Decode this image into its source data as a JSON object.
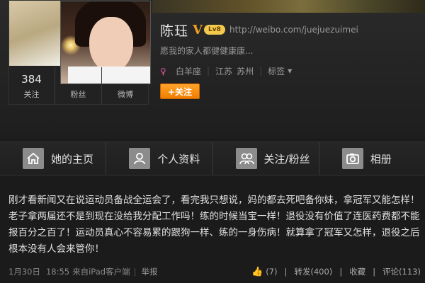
{
  "profile": {
    "name": "陈珏",
    "v_badge": "V",
    "level_badge": "Lv8",
    "url": "http://weibo.com/juejuezuimei",
    "bio": "愿我的家人都健健康康...",
    "gender_glyph": "♀",
    "zodiac": "白羊座",
    "location_province": "江苏",
    "location_city": "苏州",
    "tags_label": "标签",
    "follow_button": "+关注"
  },
  "stats": [
    {
      "value": "384",
      "label": "关注"
    },
    {
      "value": "",
      "label": "粉丝"
    },
    {
      "value": "",
      "label": "微博"
    }
  ],
  "nav": [
    {
      "label": "她的主页",
      "icon": "home-icon"
    },
    {
      "label": "个人资料",
      "icon": "person-icon"
    },
    {
      "label": "关注/粉丝",
      "icon": "people-icon"
    },
    {
      "label": "相册",
      "icon": "camera-icon"
    }
  ],
  "post": {
    "text": "刚才看新闻又在说运动员备战全运会了，看完我只想说，妈的都去死吧备你妹，拿冠军又能怎样！老子拿两届还不是到现在没给我分配工作吗！练的时候当宝一样！退役没有价值了连医药费都不能报百分之百了！运动员真心不容易累的跟狗一样、练的一身伤病！就算拿了冠军又怎样，退役之后根本没有人会来管你！",
    "date": "1月30日",
    "time": "18:55",
    "source": "来自iPad客户端",
    "report": "举报",
    "likes": "(7)",
    "repost": "转发(400)",
    "favorite": "收藏",
    "comment": "评论(113)"
  },
  "colors": {
    "background": "#1b1b1b",
    "follow_button": "#f07d00",
    "v_badge": "#f0a020",
    "like_icon": "#3a7fd6"
  }
}
